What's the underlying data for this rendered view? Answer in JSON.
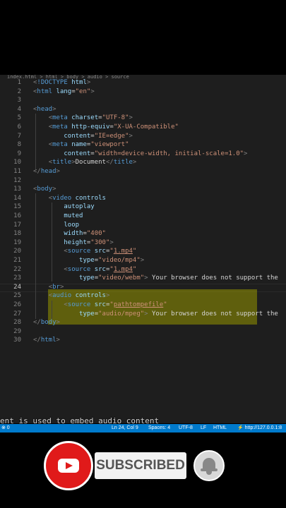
{
  "editor": {
    "breadcrumb": "index.html > html > body > audio > source",
    "current_line": 24,
    "lines": [
      {
        "n": 1,
        "parts": [
          [
            "p",
            "<"
          ],
          [
            "t",
            "!DOCTYPE"
          ],
          [
            "x",
            " "
          ],
          [
            "a",
            "html"
          ],
          [
            "p",
            ">"
          ]
        ]
      },
      {
        "n": 2,
        "parts": [
          [
            "p",
            "<"
          ],
          [
            "t",
            "html"
          ],
          [
            "x",
            " "
          ],
          [
            "a",
            "lang"
          ],
          [
            "x",
            "="
          ],
          [
            "s",
            "\"en\""
          ],
          [
            "p",
            ">"
          ]
        ]
      },
      {
        "n": 3,
        "parts": []
      },
      {
        "n": 4,
        "parts": [
          [
            "p",
            "<"
          ],
          [
            "t",
            "head"
          ],
          [
            "p",
            ">"
          ]
        ]
      },
      {
        "n": 5,
        "parts": [
          [
            "x",
            "    "
          ],
          [
            "p",
            "<"
          ],
          [
            "t",
            "meta"
          ],
          [
            "x",
            " "
          ],
          [
            "a",
            "charset"
          ],
          [
            "x",
            "="
          ],
          [
            "s",
            "\"UTF-8\""
          ],
          [
            "p",
            ">"
          ]
        ]
      },
      {
        "n": 6,
        "parts": [
          [
            "x",
            "    "
          ],
          [
            "p",
            "<"
          ],
          [
            "t",
            "meta"
          ],
          [
            "x",
            " "
          ],
          [
            "a",
            "http-equiv"
          ],
          [
            "x",
            "="
          ],
          [
            "s",
            "\"X-UA-Compatible\""
          ]
        ]
      },
      {
        "n": 7,
        "parts": [
          [
            "x",
            "        "
          ],
          [
            "a",
            "content"
          ],
          [
            "x",
            "="
          ],
          [
            "s",
            "\"IE=edge\""
          ],
          [
            "p",
            ">"
          ]
        ]
      },
      {
        "n": 8,
        "parts": [
          [
            "x",
            "    "
          ],
          [
            "p",
            "<"
          ],
          [
            "t",
            "meta"
          ],
          [
            "x",
            " "
          ],
          [
            "a",
            "name"
          ],
          [
            "x",
            "="
          ],
          [
            "s",
            "\"viewport\""
          ]
        ]
      },
      {
        "n": 9,
        "parts": [
          [
            "x",
            "        "
          ],
          [
            "a",
            "content"
          ],
          [
            "x",
            "="
          ],
          [
            "s",
            "\"width=device-width, initial-scale=1.0\""
          ],
          [
            "p",
            ">"
          ]
        ]
      },
      {
        "n": 10,
        "parts": [
          [
            "x",
            "    "
          ],
          [
            "p",
            "<"
          ],
          [
            "t",
            "title"
          ],
          [
            "p",
            ">"
          ],
          [
            "x",
            "Document"
          ],
          [
            "p",
            "</"
          ],
          [
            "t",
            "title"
          ],
          [
            "p",
            ">"
          ]
        ]
      },
      {
        "n": 11,
        "parts": [
          [
            "p",
            "</"
          ],
          [
            "t",
            "head"
          ],
          [
            "p",
            ">"
          ]
        ]
      },
      {
        "n": 12,
        "parts": []
      },
      {
        "n": 13,
        "parts": [
          [
            "p",
            "<"
          ],
          [
            "t",
            "body"
          ],
          [
            "p",
            ">"
          ]
        ]
      },
      {
        "n": 14,
        "parts": [
          [
            "x",
            "    "
          ],
          [
            "p",
            "<"
          ],
          [
            "t",
            "video"
          ],
          [
            "x",
            " "
          ],
          [
            "a",
            "controls"
          ]
        ]
      },
      {
        "n": 15,
        "parts": [
          [
            "x",
            "        "
          ],
          [
            "a",
            "autoplay"
          ]
        ]
      },
      {
        "n": 16,
        "parts": [
          [
            "x",
            "        "
          ],
          [
            "a",
            "muted"
          ]
        ]
      },
      {
        "n": 17,
        "parts": [
          [
            "x",
            "        "
          ],
          [
            "a",
            "loop"
          ]
        ]
      },
      {
        "n": 18,
        "parts": [
          [
            "x",
            "        "
          ],
          [
            "a",
            "width"
          ],
          [
            "x",
            "="
          ],
          [
            "s",
            "\"400\""
          ]
        ]
      },
      {
        "n": 19,
        "parts": [
          [
            "x",
            "        "
          ],
          [
            "a",
            "height"
          ],
          [
            "x",
            "="
          ],
          [
            "s",
            "\"300\""
          ],
          [
            "p",
            ">"
          ]
        ]
      },
      {
        "n": 20,
        "parts": [
          [
            "x",
            "        "
          ],
          [
            "p",
            "<"
          ],
          [
            "t",
            "source"
          ],
          [
            "x",
            " "
          ],
          [
            "a",
            "src"
          ],
          [
            "x",
            "="
          ],
          [
            "s",
            "\""
          ],
          [
            "su",
            "1.mp4"
          ],
          [
            "s",
            "\""
          ]
        ]
      },
      {
        "n": 21,
        "parts": [
          [
            "x",
            "            "
          ],
          [
            "a",
            "type"
          ],
          [
            "x",
            "="
          ],
          [
            "s",
            "\"video/mp4\""
          ],
          [
            "p",
            ">"
          ]
        ]
      },
      {
        "n": 22,
        "parts": [
          [
            "x",
            "        "
          ],
          [
            "p",
            "<"
          ],
          [
            "t",
            "source"
          ],
          [
            "x",
            " "
          ],
          [
            "a",
            "src"
          ],
          [
            "x",
            "="
          ],
          [
            "s",
            "\""
          ],
          [
            "su",
            "1.mp4"
          ],
          [
            "s",
            "\""
          ]
        ]
      },
      {
        "n": 23,
        "parts": [
          [
            "x",
            "            "
          ],
          [
            "a",
            "type"
          ],
          [
            "x",
            "="
          ],
          [
            "s",
            "\"video/webm\""
          ],
          [
            "p",
            ">"
          ],
          [
            "x",
            " Your browser does not support the"
          ]
        ]
      },
      {
        "n": 24,
        "parts": [
          [
            "x",
            "    "
          ],
          [
            "p",
            "<"
          ],
          [
            "t",
            "br"
          ],
          [
            "p",
            ">"
          ]
        ]
      },
      {
        "n": 25,
        "parts": [
          [
            "x",
            "    "
          ],
          [
            "p",
            "<"
          ],
          [
            "t",
            "audio"
          ],
          [
            "x",
            " "
          ],
          [
            "a",
            "controls"
          ],
          [
            "p",
            ">"
          ]
        ]
      },
      {
        "n": 26,
        "parts": [
          [
            "x",
            "        "
          ],
          [
            "p",
            "<"
          ],
          [
            "t",
            "source"
          ],
          [
            "x",
            " "
          ],
          [
            "a",
            "src"
          ],
          [
            "x",
            "="
          ],
          [
            "s",
            "\""
          ],
          [
            "su",
            "pathtompefile"
          ],
          [
            "s",
            "\""
          ]
        ]
      },
      {
        "n": 27,
        "parts": [
          [
            "x",
            "            "
          ],
          [
            "a",
            "type"
          ],
          [
            "x",
            "="
          ],
          [
            "s",
            "\"audio/mpeg\""
          ],
          [
            "p",
            ">"
          ],
          [
            "x",
            " Your browser does not support the"
          ]
        ]
      },
      {
        "n": 28,
        "parts": [
          [
            "p",
            "</"
          ],
          [
            "t",
            "body"
          ],
          [
            "p",
            ">"
          ]
        ]
      },
      {
        "n": 29,
        "parts": []
      },
      {
        "n": 30,
        "parts": [
          [
            "p",
            "</"
          ],
          [
            "t",
            "html"
          ],
          [
            "p",
            ">"
          ]
        ]
      }
    ]
  },
  "caption": "ent is used to embed audio content",
  "statusbar": {
    "left": "⊗ 0",
    "position": "Ln 24, Col 9",
    "spaces": "Spaces: 4",
    "encoding": "UTF-8",
    "eol": "LF",
    "language": "HTML",
    "live": "⚡ http://127.0.0.1:8"
  },
  "overlay": {
    "subscribed_label": "SUBSCRIBED",
    "accent_red": "#e01a1a"
  }
}
